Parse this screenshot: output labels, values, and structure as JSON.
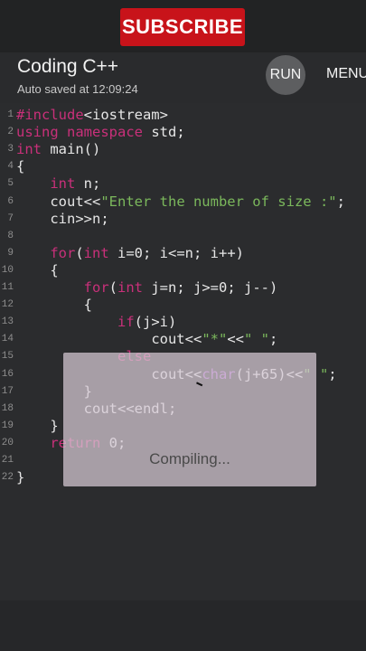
{
  "banner": {
    "label": "SUBSCRIBE"
  },
  "header": {
    "title": "Coding C++",
    "autosave": "Auto saved at 12:09:24",
    "run_label": "RUN",
    "menu_label": "MENU"
  },
  "colors": {
    "keyword": "#c9307a",
    "type": "#ad5bd0",
    "string": "#7bb85c",
    "default": "#e6e6e6"
  },
  "lines": [
    {
      "n": "1",
      "indent": "",
      "tokens": [
        [
          "#include",
          "kw"
        ],
        [
          "<iostream>",
          "d"
        ]
      ]
    },
    {
      "n": "2",
      "indent": "",
      "tokens": [
        [
          "using",
          "kw"
        ],
        [
          " ",
          "d"
        ],
        [
          "namespace",
          "kw"
        ],
        [
          " std;",
          "d"
        ]
      ]
    },
    {
      "n": "3",
      "indent": "",
      "tokens": [
        [
          "int",
          "kw"
        ],
        [
          " main()",
          "d"
        ]
      ]
    },
    {
      "n": "4",
      "indent": "",
      "tokens": [
        [
          "{",
          "d"
        ]
      ]
    },
    {
      "n": "5",
      "indent": "    ",
      "tokens": [
        [
          "int",
          "kw"
        ],
        [
          " n;",
          "d"
        ]
      ]
    },
    {
      "n": "6",
      "indent": "    ",
      "tokens": [
        [
          "cout<<",
          "d"
        ],
        [
          "\"Enter the number of size :\"",
          "str"
        ],
        [
          ";",
          "d"
        ]
      ]
    },
    {
      "n": "7",
      "indent": "    ",
      "tokens": [
        [
          "cin>>n;",
          "d"
        ]
      ]
    },
    {
      "n": "8",
      "indent": "",
      "tokens": []
    },
    {
      "n": "9",
      "indent": "    ",
      "tokens": [
        [
          "for",
          "kw"
        ],
        [
          "(",
          "d"
        ],
        [
          "int",
          "kw"
        ],
        [
          " i=0; i<=n; i++)",
          "d"
        ]
      ]
    },
    {
      "n": "10",
      "indent": "    ",
      "tokens": [
        [
          "{",
          "d"
        ]
      ]
    },
    {
      "n": "11",
      "indent": "        ",
      "tokens": [
        [
          "for",
          "kw"
        ],
        [
          "(",
          "d"
        ],
        [
          "int",
          "kw"
        ],
        [
          " j=n; j>=0; j--)",
          "d"
        ]
      ]
    },
    {
      "n": "12",
      "indent": "        ",
      "tokens": [
        [
          "{",
          "d"
        ]
      ]
    },
    {
      "n": "13",
      "indent": "            ",
      "tokens": [
        [
          "if",
          "kw"
        ],
        [
          "(j>i)",
          "d"
        ]
      ]
    },
    {
      "n": "14",
      "indent": "                ",
      "tokens": [
        [
          "cout<<",
          "d"
        ],
        [
          "\"*\"",
          "str"
        ],
        [
          "<<",
          "d"
        ],
        [
          "\" \"",
          "str"
        ],
        [
          ";",
          "d"
        ]
      ]
    },
    {
      "n": "15",
      "indent": "            ",
      "tokens": [
        [
          "else",
          "kw"
        ]
      ]
    },
    {
      "n": "16",
      "indent": "                ",
      "tokens": [
        [
          "cout<<",
          "d"
        ],
        [
          "char",
          "ty"
        ],
        [
          "(j+65)<<",
          "d"
        ],
        [
          "\" \"",
          "str"
        ],
        [
          ";",
          "d"
        ]
      ]
    },
    {
      "n": "17",
      "indent": "        ",
      "tokens": [
        [
          "}",
          "d"
        ]
      ]
    },
    {
      "n": "18",
      "indent": "        ",
      "tokens": [
        [
          "cout<<endl;",
          "d"
        ]
      ]
    },
    {
      "n": "19",
      "indent": "    ",
      "tokens": [
        [
          "}",
          "d"
        ]
      ]
    },
    {
      "n": "20",
      "indent": "    ",
      "tokens": [
        [
          "return",
          "kw"
        ],
        [
          " 0;",
          "d"
        ]
      ]
    },
    {
      "n": "21",
      "indent": "",
      "tokens": []
    },
    {
      "n": "22",
      "indent": "",
      "tokens": [
        [
          "}",
          "d"
        ]
      ]
    }
  ],
  "dialog": {
    "message": "Compiling..."
  }
}
